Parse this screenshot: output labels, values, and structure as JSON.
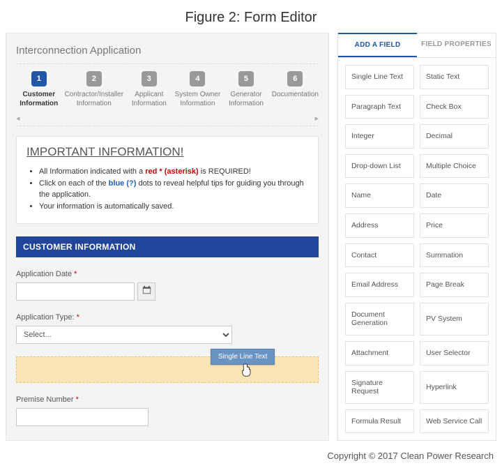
{
  "figure_title": "Figure 2: Form Editor",
  "form": {
    "title": "Interconnection Application",
    "steps": [
      {
        "num": "1",
        "label": "Customer Information",
        "active": true
      },
      {
        "num": "2",
        "label": "Contractor/Installer Information",
        "active": false
      },
      {
        "num": "3",
        "label": "Applicant Information",
        "active": false
      },
      {
        "num": "4",
        "label": "System Owner Information",
        "active": false
      },
      {
        "num": "5",
        "label": "Generator Information",
        "active": false
      },
      {
        "num": "6",
        "label": "Documentation",
        "active": false
      }
    ],
    "step_nav": {
      "prev_glyph": "◂",
      "next_glyph": "▸"
    },
    "important": {
      "heading": "IMPORTANT INFORMATION!",
      "b1_pre": "All Information indicated with a ",
      "b1_red": "red * (asterisk)",
      "b1_post": " is REQUIRED!",
      "b2_pre": "Click on each of the ",
      "b2_blue": "blue (?)",
      "b2_post": " dots to reveal helpful tips for guiding you through the application.",
      "b3": "Your information is automatically saved."
    },
    "section_header": "CUSTOMER INFORMATION",
    "fields": {
      "application_date": {
        "label": "Application Date",
        "required": "*",
        "value": ""
      },
      "application_type": {
        "label": "Application Type:",
        "required": "*",
        "selected": "Select..."
      },
      "premise_number": {
        "label": "Premise Number",
        "required": "*",
        "value": ""
      }
    },
    "drag_chip_label": "Single Line Text"
  },
  "right": {
    "tabs": {
      "add": "ADD A FIELD",
      "props": "FIELD PROPERTIES"
    },
    "palette": [
      "Single Line Text",
      "Static Text",
      "Paragraph Text",
      "Check Box",
      "Integer",
      "Decimal",
      "Drop-down List",
      "Multiple Choice",
      "Name",
      "Date",
      "Address",
      "Price",
      "Contact",
      "Summation",
      "Email Address",
      "Page Break",
      "Document Generation",
      "PV System",
      "Attachment",
      "User Selector",
      "Signature Request",
      "Hyperlink",
      "Formula Result",
      "Web Service Call"
    ]
  },
  "copyright": "Copyright © 2017 Clean Power Research"
}
